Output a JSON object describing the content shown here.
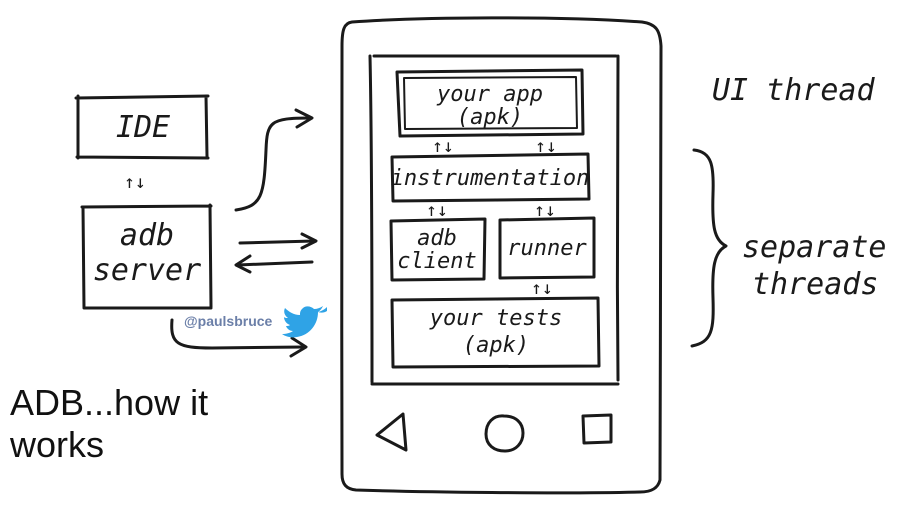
{
  "diagram": {
    "nodes": {
      "ide": "IDE",
      "adb_server": [
        "adb",
        "server"
      ],
      "your_app": [
        "your app",
        "(apk)"
      ],
      "instrumentation": "instrumentation",
      "adb_client": [
        "adb",
        "client"
      ],
      "runner": "runner",
      "your_tests": [
        "your tests",
        "(apk)"
      ]
    },
    "labels": {
      "ui_thread": "UI thread",
      "separate_threads": [
        "separate",
        "threads"
      ]
    },
    "sync_glyph": "↑↓",
    "twitter_handle": "@paulsbruce",
    "caption": "ADB...how it works"
  },
  "colors": {
    "ink": "#1a1a1a",
    "twitter_blue": "#2fa3e6",
    "handle_text": "#6b7fa8"
  },
  "icons": {
    "twitter": "twitter-bird-icon",
    "back": "back-triangle-icon",
    "home": "home-circle-icon",
    "recents": "recents-square-icon"
  }
}
